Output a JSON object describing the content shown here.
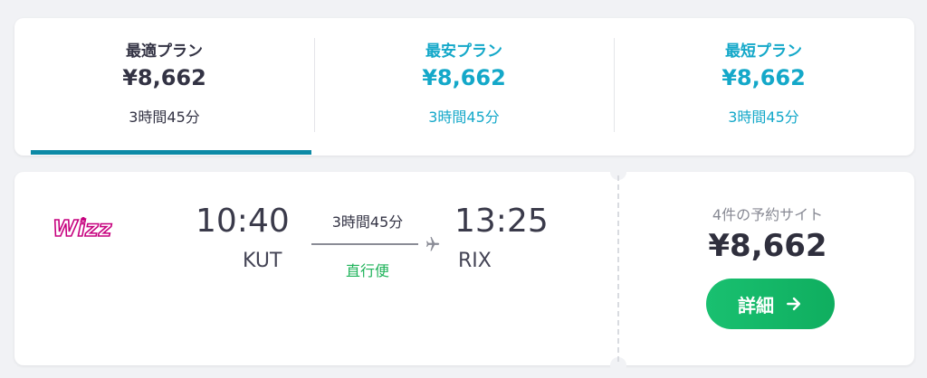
{
  "tabs": [
    {
      "label": "最適プラン",
      "price": "¥8,662",
      "duration": "3時間45分",
      "selected": true
    },
    {
      "label": "最安プラン",
      "price": "¥8,662",
      "duration": "3時間45分",
      "selected": false
    },
    {
      "label": "最短プラン",
      "price": "¥8,662",
      "duration": "3時間45分",
      "selected": false
    }
  ],
  "flight": {
    "airline_logo_text": "Wizz",
    "departure_time": "10:40",
    "departure_airport": "KUT",
    "duration": "3時間45分",
    "stops": "直行便",
    "arrival_time": "13:25",
    "arrival_airport": "RIX"
  },
  "booking": {
    "site_count": "4件の予約サイト",
    "price": "¥8,662",
    "button_label": "詳細"
  },
  "colors": {
    "accent_blue": "#14a8c9",
    "underline": "#0d8aa6",
    "green": "#19c070",
    "logo_purple": "#c6007e"
  },
  "icons": {
    "plane": "plane-icon",
    "arrow": "arrow-right-icon"
  }
}
